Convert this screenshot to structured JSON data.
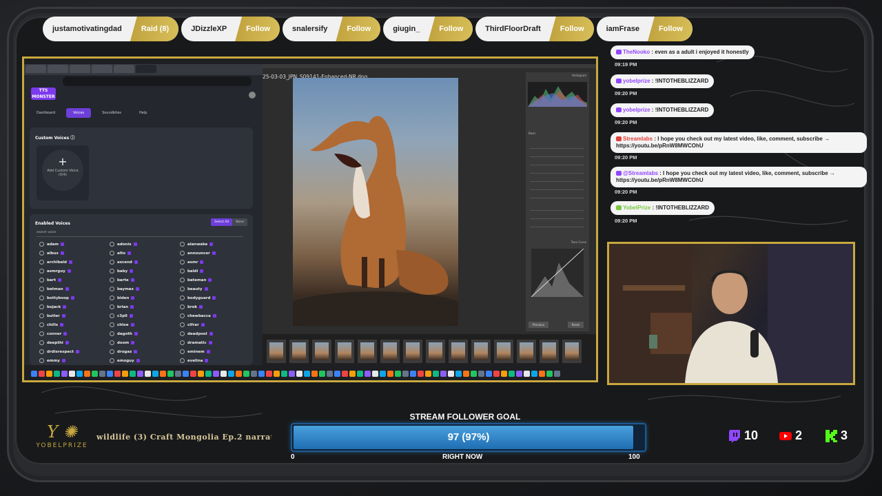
{
  "pills": [
    {
      "name": "justamotivatingdad",
      "action": "Raid (8)"
    },
    {
      "name": "JDizzleXP",
      "action": "Follow"
    },
    {
      "name": "snalersify",
      "action": "Follow"
    },
    {
      "name": "giugin_",
      "action": "Follow"
    },
    {
      "name": "ThirdFloorDraft",
      "action": "Follow"
    },
    {
      "name": "iamFrase",
      "action": "Follow"
    }
  ],
  "browser": {
    "logo": "TTS MONSTER",
    "nav": [
      "Dashboard",
      "Voices",
      "Soundbites",
      "Help"
    ],
    "custom_voices_title": "Custom Voices",
    "add_label": "Add Custom Voice",
    "add_count": "(0/4)",
    "enabled_title": "Enabled Voices",
    "select_all": "Select All",
    "none": "None",
    "search_placeholder": "search voice",
    "voices_col1": [
      "adam",
      "albus",
      "archibald",
      "asmrguy",
      "bart",
      "batman",
      "bottyboop",
      "bojack",
      "butler",
      "chills",
      "conner",
      "deepthi",
      "drdisrespect",
      "emmy"
    ],
    "voices_col2": [
      "adonis",
      "alto",
      "ascend",
      "baby",
      "barte",
      "baymax",
      "biden",
      "brian",
      "c3p0",
      "chloe",
      "dagoth",
      "doom",
      "drogaz",
      "emoguy"
    ],
    "voices_col3": [
      "alanwake",
      "announcer",
      "asmr",
      "baldi",
      "bateman",
      "beauty",
      "bodyguard",
      "brok",
      "chewbacca",
      "cifrar",
      "deadpool",
      "dramatic",
      "eminem",
      "evelina"
    ]
  },
  "lightroom": {
    "filename": "25-03-03_JPN_S09141-Enhanced-NR.dng",
    "panel_histogram": "Histogram",
    "panel_basic": "Basic",
    "panel_tone_curve": "Tone Curve",
    "prev_btn": "Previous",
    "reset_btn": "Reset"
  },
  "chat": [
    {
      "user": "TheNooko",
      "user_color": "#9146ff",
      "text": "even as a adult i enjoyed it honestly",
      "time": "09:19 PM"
    },
    {
      "user": "yobelprize",
      "user_color": "#9146ff",
      "text": "!INTOTHEBLIZZARD",
      "time": "09:20 PM"
    },
    {
      "user": "yobelprize",
      "user_color": "#9146ff",
      "text": "!INTOTHEBLIZZARD",
      "time": "09:20 PM"
    },
    {
      "user": "Streamlabs",
      "user_color": "#e0413a",
      "text": "I hope you check out my latest video, like, comment, subscribe → https://youtu.be/pRnW8MWCOhU",
      "time": "09:20 PM"
    },
    {
      "user": "@Streamlabs",
      "user_color": "#9146ff",
      "text": "I hope you check out my latest video, like, comment, subscribe → https://youtu.be/pRnW8MWCOhU",
      "time": "09:20 PM"
    },
    {
      "user": "YobelPrize",
      "user_color": "#7ac943",
      "text": "!INTOTHEBLIZZARD",
      "time": "09:20 PM"
    }
  ],
  "brand": {
    "name": "YOBELPRIZE",
    "accent": "#c8a93f"
  },
  "ticker": "wildlife (3) Craft Mongolia Ep.2 narrat",
  "goal": {
    "title": "STREAM FOLLOWER GOAL",
    "value_text": "97 (97%)",
    "progress": 0.97,
    "min": "0",
    "max": "100",
    "caption": "RIGHT NOW"
  },
  "stats": [
    {
      "icon": "twitch-icon",
      "value": "10",
      "color": "#9146ff"
    },
    {
      "icon": "youtube-icon",
      "value": "2",
      "color": "#ff0000"
    },
    {
      "icon": "kick-icon",
      "value": "3",
      "color": "#53fc18"
    }
  ]
}
